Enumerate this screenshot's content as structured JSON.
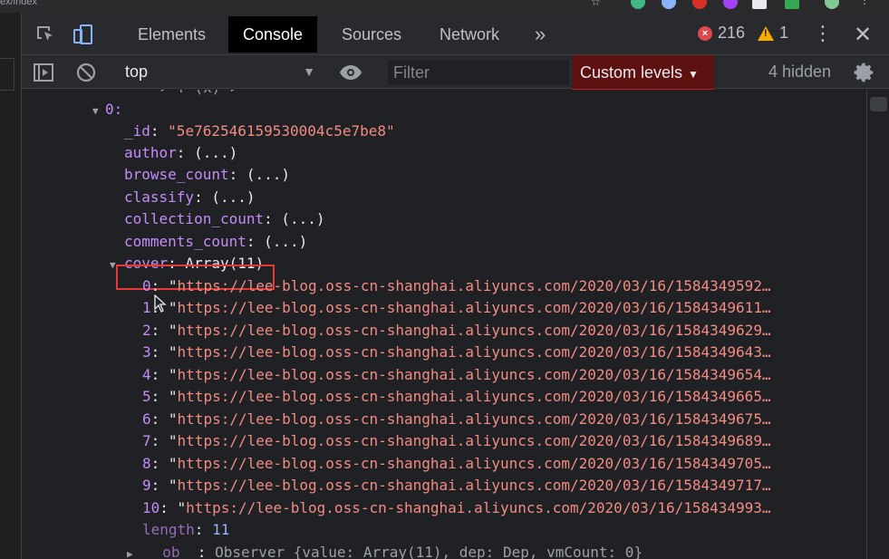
{
  "browser": {
    "url_fragment": "ex/index"
  },
  "devtools": {
    "tabs": [
      {
        "label": "Elements",
        "active": false
      },
      {
        "label": "Console",
        "active": true
      },
      {
        "label": "Sources",
        "active": false
      },
      {
        "label": "Network",
        "active": false
      }
    ],
    "more_tabs": "»",
    "error_count": "216",
    "warning_count": "1",
    "toolbar": {
      "context": "top",
      "filter_placeholder": "Filter",
      "levels_label": "Custom levels",
      "hidden_label": "4 hidden"
    }
  },
  "console": {
    "object_index": "0:",
    "fields": [
      {
        "key": "_id",
        "value": "\"5e762546159530004c5e7be8\"",
        "type": "string"
      },
      {
        "key": "author",
        "value": "(...)",
        "type": "lazy"
      },
      {
        "key": "browse_count",
        "value": "(...)",
        "type": "lazy"
      },
      {
        "key": "classify",
        "value": "(...)",
        "type": "lazy"
      },
      {
        "key": "collection_count",
        "value": "(...)",
        "type": "lazy"
      },
      {
        "key": "comments_count",
        "value": "(...)",
        "type": "lazy"
      }
    ],
    "cover": {
      "key": "cover",
      "value": "Array(11)",
      "items": [
        {
          "index": "0",
          "url": "https://lee-blog.oss-cn-shanghai.aliyuncs.com/2020/03/16/1584349592…"
        },
        {
          "index": "1",
          "url": "https://lee-blog.oss-cn-shanghai.aliyuncs.com/2020/03/16/1584349611…"
        },
        {
          "index": "2",
          "url": "https://lee-blog.oss-cn-shanghai.aliyuncs.com/2020/03/16/1584349629…"
        },
        {
          "index": "3",
          "url": "https://lee-blog.oss-cn-shanghai.aliyuncs.com/2020/03/16/1584349643…"
        },
        {
          "index": "4",
          "url": "https://lee-blog.oss-cn-shanghai.aliyuncs.com/2020/03/16/1584349654…"
        },
        {
          "index": "5",
          "url": "https://lee-blog.oss-cn-shanghai.aliyuncs.com/2020/03/16/1584349665…"
        },
        {
          "index": "6",
          "url": "https://lee-blog.oss-cn-shanghai.aliyuncs.com/2020/03/16/1584349675…"
        },
        {
          "index": "7",
          "url": "https://lee-blog.oss-cn-shanghai.aliyuncs.com/2020/03/16/1584349689…"
        },
        {
          "index": "8",
          "url": "https://lee-blog.oss-cn-shanghai.aliyuncs.com/2020/03/16/1584349705…"
        },
        {
          "index": "9",
          "url": "https://lee-blog.oss-cn-shanghai.aliyuncs.com/2020/03/16/1584349717…"
        },
        {
          "index": "10",
          "url": "https://lee-blog.oss-cn-shanghai.aliyuncs.com/2020/03/16/158434993…"
        }
      ],
      "length_key": "length",
      "length_value": "11",
      "observer_key": "__ob__",
      "observer_value": "Observer {value: Array(11), dep: Dep, vmCount: 0}"
    }
  },
  "colors": {
    "key": "#c58af9",
    "string": "#f28b82",
    "number": "#9ab4f8",
    "highlight": "#e53935",
    "levels_bg": "#5e1111"
  }
}
